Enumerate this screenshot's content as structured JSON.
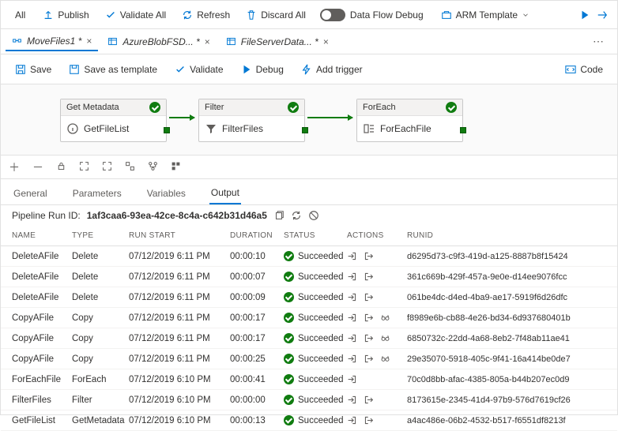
{
  "toolbar": {
    "all": "All",
    "publish": "Publish",
    "validate_all": "Validate All",
    "refresh": "Refresh",
    "discard_all": "Discard All",
    "data_flow_debug": "Data Flow Debug",
    "arm_template": "ARM Template"
  },
  "tabs": [
    {
      "label": "MoveFiles1 *",
      "type": "pipeline",
      "active": true
    },
    {
      "label": "AzureBlobFSD... *",
      "type": "dataset",
      "active": false
    },
    {
      "label": "FileServerData... *",
      "type": "dataset",
      "active": false
    }
  ],
  "actions": {
    "save": "Save",
    "save_as_template": "Save as template",
    "validate": "Validate",
    "debug": "Debug",
    "add_trigger": "Add trigger",
    "code": "Code"
  },
  "nodes": [
    {
      "type": "Get Metadata",
      "name": "GetFileList"
    },
    {
      "type": "Filter",
      "name": "FilterFiles"
    },
    {
      "type": "ForEach",
      "name": "ForEachFile"
    }
  ],
  "sub_tabs": [
    "General",
    "Parameters",
    "Variables",
    "Output"
  ],
  "sub_tab_active": 3,
  "run_id_label": "Pipeline Run ID:",
  "run_id": "1af3caa6-93ea-42ce-8c4a-c642b31d46a5",
  "columns": {
    "name": "NAME",
    "type": "TYPE",
    "run_start": "RUN START",
    "duration": "DURATION",
    "status": "STATUS",
    "actions": "ACTIONS",
    "runid": "RUNID"
  },
  "status_label": "Succeeded",
  "rows": [
    {
      "name": "DeleteAFile",
      "type": "Delete",
      "start": "07/12/2019 6:11 PM",
      "dur": "00:00:10",
      "actions": [
        "in",
        "out"
      ],
      "id": "d6295d73-c9f3-419d-a125-8887b8f15424"
    },
    {
      "name": "DeleteAFile",
      "type": "Delete",
      "start": "07/12/2019 6:11 PM",
      "dur": "00:00:07",
      "actions": [
        "in",
        "out"
      ],
      "id": "361c669b-429f-457a-9e0e-d14ee9076fcc"
    },
    {
      "name": "DeleteAFile",
      "type": "Delete",
      "start": "07/12/2019 6:11 PM",
      "dur": "00:00:09",
      "actions": [
        "in",
        "out"
      ],
      "id": "061be4dc-d4ed-4ba9-ae17-5919f6d26dfc"
    },
    {
      "name": "CopyAFile",
      "type": "Copy",
      "start": "07/12/2019 6:11 PM",
      "dur": "00:00:17",
      "actions": [
        "in",
        "out",
        "glasses"
      ],
      "id": "f8989e6b-cb88-4e26-bd34-6d937680401b"
    },
    {
      "name": "CopyAFile",
      "type": "Copy",
      "start": "07/12/2019 6:11 PM",
      "dur": "00:00:17",
      "actions": [
        "in",
        "out",
        "glasses"
      ],
      "id": "6850732c-22dd-4a68-8eb2-7f48ab11ae41"
    },
    {
      "name": "CopyAFile",
      "type": "Copy",
      "start": "07/12/2019 6:11 PM",
      "dur": "00:00:25",
      "actions": [
        "in",
        "out",
        "glasses"
      ],
      "id": "29e35070-5918-405c-9f41-16a414be0de7"
    },
    {
      "name": "ForEachFile",
      "type": "ForEach",
      "start": "07/12/2019 6:10 PM",
      "dur": "00:00:41",
      "actions": [
        "in"
      ],
      "id": "70c0d8bb-afac-4385-805a-b44b207ec0d9"
    },
    {
      "name": "FilterFiles",
      "type": "Filter",
      "start": "07/12/2019 6:10 PM",
      "dur": "00:00:00",
      "actions": [
        "in",
        "out"
      ],
      "id": "8173615e-2345-41d4-97b9-576d7619cf26"
    },
    {
      "name": "GetFileList",
      "type": "GetMetadata",
      "start": "07/12/2019 6:10 PM",
      "dur": "00:00:13",
      "actions": [
        "in",
        "out"
      ],
      "id": "a4ac486e-06b2-4532-b517-f6551df8213f"
    }
  ]
}
